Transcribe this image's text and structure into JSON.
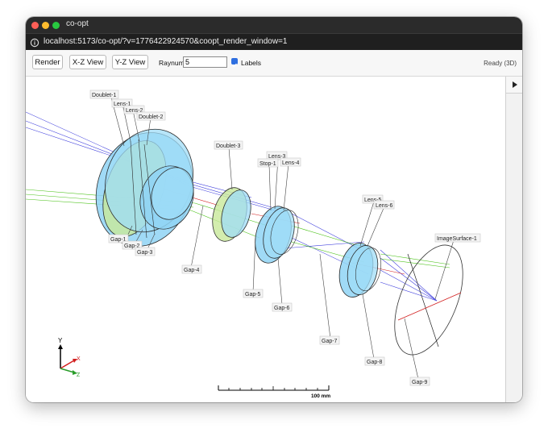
{
  "window": {
    "title": "co-opt"
  },
  "browser": {
    "url": "localhost:5173/co-opt/?v=1776422924570&coopt_render_window=1"
  },
  "toolbar": {
    "render_label": "Render",
    "xz_label": "X-Z View",
    "yz_label": "Y-Z View",
    "raynum_label": "Raynum",
    "raynum_value": "5",
    "labels_label": "Labels",
    "labels_checked": true,
    "status": "Ready (3D)"
  },
  "scene": {
    "labels": {
      "doublet1": "Doublet-1",
      "lens1": "Lens-1",
      "lens2": "Lens-2",
      "doublet2": "Doublet-2",
      "doublet3": "Doublet-3",
      "lens3": "Lens-3",
      "stop1": "Stop-1",
      "lens4": "Lens-4",
      "lens5": "Lens-5",
      "lens6": "Lens-6",
      "imagesurface1": "ImageSurface-1",
      "gap1": "Gap-1",
      "gap2": "Gap-2",
      "gap3": "Gap-3",
      "gap4": "Gap-4",
      "gap5": "Gap-5",
      "gap6": "Gap-6",
      "gap7": "Gap-7",
      "gap8": "Gap-8",
      "gap9": "Gap-9"
    },
    "axes": {
      "y": "Y",
      "x": "X",
      "z": "Z"
    },
    "scalebar": "100 mm",
    "colors": {
      "lens_fill": "#8fd3f4",
      "lens_edge": "#2c2c2c",
      "ray_blue": "#3a3adc",
      "ray_green": "#4cc21a",
      "ray_red": "#d21e1e"
    }
  },
  "sidepanel": {
    "toggle_icon": "play-triangle-icon"
  }
}
